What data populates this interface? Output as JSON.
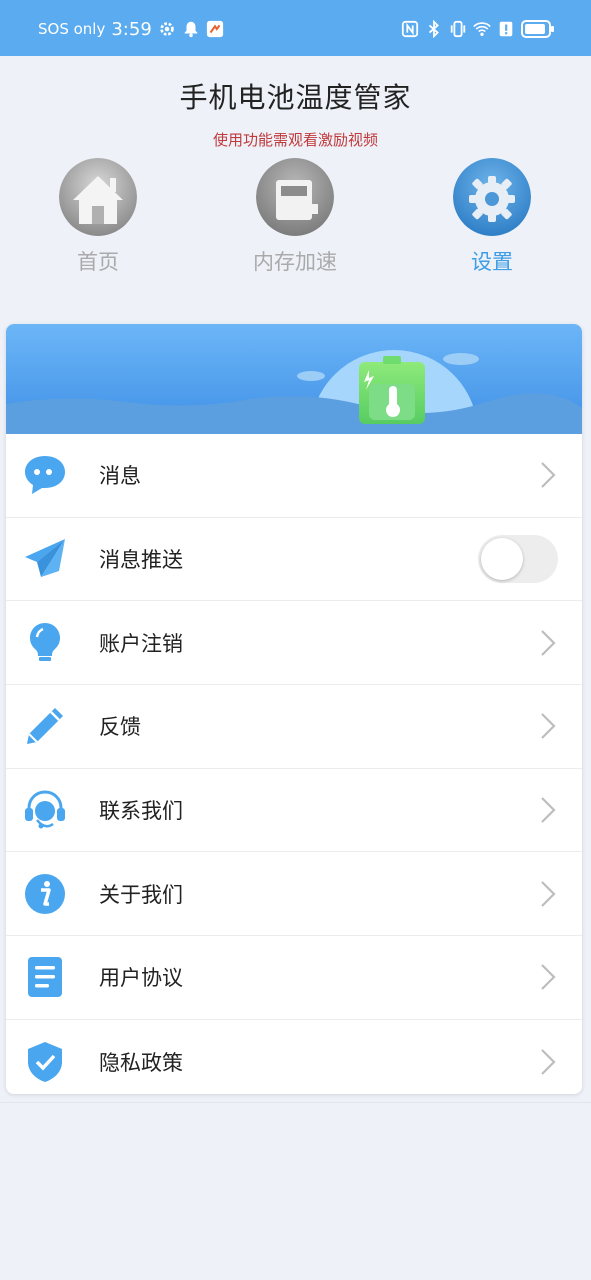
{
  "status_bar": {
    "sos": "SOS only",
    "time": "3:59",
    "icons": [
      "gear-icon",
      "bell-icon",
      "app-notification-icon",
      "nfc-icon",
      "bluetooth-icon",
      "vibrate-icon",
      "wifi-icon",
      "alert-icon",
      "battery-icon"
    ]
  },
  "header": {
    "title": "手机电池温度管家",
    "subtitle": "使用功能需观看激励视频"
  },
  "tabs": [
    {
      "label": "首页",
      "icon": "home-icon",
      "active": false
    },
    {
      "label": "内存加速",
      "icon": "memory-icon",
      "active": false
    },
    {
      "label": "设置",
      "icon": "gear-icon",
      "active": true
    }
  ],
  "banner": {
    "icon": "battery-thermometer-icon"
  },
  "menu": [
    {
      "label": "消息",
      "icon": "message-icon",
      "control": "chevron"
    },
    {
      "label": "消息推送",
      "icon": "paper-plane-icon",
      "control": "toggle",
      "toggle_on": false
    },
    {
      "label": "账户注销",
      "icon": "lightbulb-icon",
      "control": "chevron"
    },
    {
      "label": "反馈",
      "icon": "pencil-icon",
      "control": "chevron"
    },
    {
      "label": "联系我们",
      "icon": "headset-icon",
      "control": "chevron"
    },
    {
      "label": "关于我们",
      "icon": "info-icon",
      "control": "chevron"
    },
    {
      "label": "用户协议",
      "icon": "document-icon",
      "control": "chevron"
    },
    {
      "label": "隐私政策",
      "icon": "shield-check-icon",
      "control": "chevron"
    }
  ],
  "colors": {
    "status_bar": "#5aabf0",
    "accent": "#3d9de6",
    "icon_blue": "#4aa6ee",
    "subtitle_red": "#c0393b",
    "background": "#eef1f8"
  }
}
